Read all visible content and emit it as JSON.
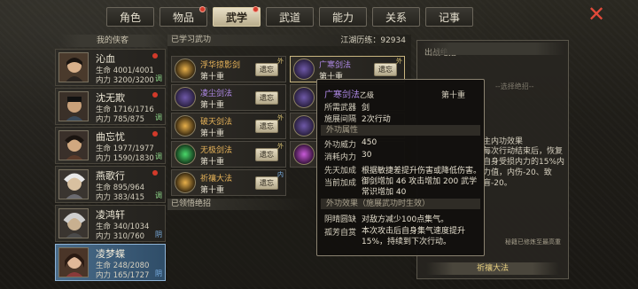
{
  "tabs": [
    {
      "label": "角色",
      "dot": false
    },
    {
      "label": "物品",
      "dot": true
    },
    {
      "label": "武学",
      "dot": true,
      "active": true
    },
    {
      "label": "武道",
      "dot": false
    },
    {
      "label": "能力",
      "dot": false
    },
    {
      "label": "关系",
      "dot": false
    },
    {
      "label": "记事",
      "dot": false
    }
  ],
  "left": {
    "title": "我的侠客",
    "chars": [
      {
        "name": "沁血",
        "hp": "生命 4001/4001",
        "mp": "内力 3200/3200",
        "tag": "调",
        "dot": true
      },
      {
        "name": "沈无欺",
        "hp": "生命 1716/1716",
        "mp": "内力 785/875",
        "tag": "调",
        "dot": true
      },
      {
        "name": "曲忘忧",
        "hp": "生命 1977/1977",
        "mp": "内力 1590/1830",
        "tag": "调",
        "dot": true
      },
      {
        "name": "燕歌行",
        "hp": "生命 895/964",
        "mp": "内力 383/415",
        "tag": "调",
        "dot": true
      },
      {
        "name": "凌鸿轩",
        "hp": "生命 340/1034",
        "mp": "内力 310/760",
        "tag": "阴",
        "dot": false
      },
      {
        "name": "凌梦蝶",
        "hp": "生命 248/2080",
        "mp": "内力 165/1727",
        "tag": "阴",
        "dot": false
      }
    ]
  },
  "middle": {
    "learned_title": "已学习武功",
    "exp": "江湖历练：92934",
    "forget_label": "遗忘",
    "forgotten_title": "已领悟绝招",
    "skills": [
      {
        "name": "浮华掠影剑",
        "level": "第十重",
        "tag": "外"
      },
      {
        "name": "广寒剑法",
        "level": "第十重",
        "tag": "外"
      },
      {
        "name": "凌尘剑法",
        "level": "第十重",
        "tag": ""
      },
      {
        "name": "",
        "level": "",
        "tag": ""
      },
      {
        "name": "破天剑法",
        "level": "第十重",
        "tag": "外"
      },
      {
        "name": "",
        "level": "",
        "tag": ""
      },
      {
        "name": "无极剑法",
        "level": "第十重",
        "tag": "外"
      },
      {
        "name": "",
        "level": "",
        "tag": ""
      },
      {
        "name": "祈禳大法",
        "level": "第十重",
        "tag": "内"
      }
    ]
  },
  "right": {
    "title": "出战绝招",
    "slot_placeholder": "--选择绝招--",
    "effect_title": "主内功效果",
    "effect_text": "每次行动结束后，恢复自身受损内力的15%内力值，内伤-20、致盲-20。",
    "note": "秘籍已修炼至最高重",
    "bottom_label": "祈禳大法"
  },
  "tooltip": {
    "name": "广寒剑法",
    "grade": "乙级",
    "level": "第十重",
    "weapon_label": "所需武器",
    "weapon": "剑",
    "interval_label": "施展间隔",
    "interval": "2次行动",
    "attr_header": "外功属性",
    "power_label": "外功威力",
    "power": "450",
    "cost_label": "消耗内力",
    "cost": "30",
    "pre_label": "先天加成",
    "pre_text": "根据敏捷差提升伤害或降低伤害。",
    "cur_label": "当前加成",
    "cur_text": "御剑增加 46 攻击增加 200 武学常识增加 40",
    "effect_header": "外功效果（施展武功时生效）",
    "eff1_label": "阴晴圆缺",
    "eff1_text": "对敌方减少100点集气。",
    "eff2_label": "孤芳自赏",
    "eff2_text": "本次攻击后自身集气速度提升15%，持续到下次行动。"
  }
}
